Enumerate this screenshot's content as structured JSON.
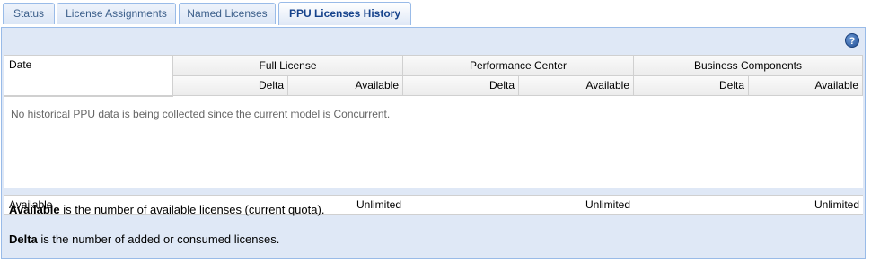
{
  "tabs": [
    {
      "label": "Status"
    },
    {
      "label": "License Assignments"
    },
    {
      "label": "Named Licenses"
    },
    {
      "label": "PPU Licenses History"
    }
  ],
  "grid": {
    "date_header": "Date",
    "groups": [
      "Full License",
      "Performance Center",
      "Business Components"
    ],
    "sub_headers": [
      "Delta",
      "Available"
    ],
    "empty_message": "No historical PPU data is being collected since the current model is Concurrent."
  },
  "footer": {
    "label": "Available",
    "values": [
      "Unlimited",
      "Unlimited",
      "Unlimited"
    ]
  },
  "legend": {
    "available_term": "Available",
    "available_text": " is the number of available licenses (current quota).",
    "delta_term": "Delta",
    "delta_text": " is the number of added or consumed licenses."
  },
  "icons": {
    "help": "help-icon"
  }
}
